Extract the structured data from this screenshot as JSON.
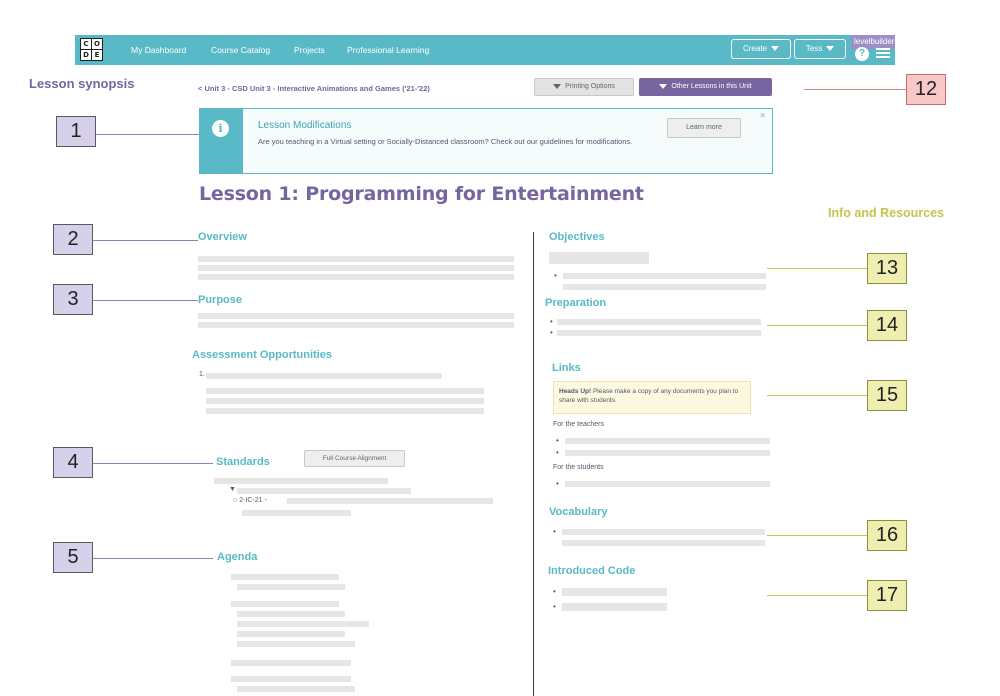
{
  "nav": {
    "logo_letters": [
      "C",
      "O",
      "D",
      "E"
    ],
    "links": [
      "My Dashboard",
      "Course Catalog",
      "Projects",
      "Professional Learning"
    ],
    "create_label": "Create",
    "user_label": "Tess",
    "levelbuilder_label": "levelbuilder"
  },
  "headings": {
    "lesson_synopsis": "Lesson synopsis",
    "info_resources": "Info and Resources"
  },
  "breadcrumb": "< Unit 3 - CSD Unit 3 - Interactive Animations and Games ('21-'22)",
  "buttons": {
    "printing": "Printing Options",
    "other_lessons": "Other Lessons in this Unit",
    "learn_more": "Learn more",
    "full_alignment": "Full Course Alignment"
  },
  "banner": {
    "title": "Lesson Modifications",
    "text": "Are you teaching in a Virtual setting or Socially-Distanced classroom? Check out our guidelines for modifications.",
    "close": "×"
  },
  "lesson_title": "Lesson 1: Programming for Entertainment",
  "left_sections": {
    "overview": "Overview",
    "purpose": "Purpose",
    "assessment": "Assessment Opportunities",
    "assessment_number": "1.",
    "standards": "Standards",
    "standard_code": "2-IC-21 -",
    "agenda": "Agenda"
  },
  "right_sections": {
    "objectives": "Objectives",
    "preparation": "Preparation",
    "links": "Links",
    "headsup_bold": "Heads Up!",
    "headsup_text": " Please make a copy of any documents you plan to share with students.",
    "for_teachers": "For the teachers",
    "for_students": "For the students",
    "vocabulary": "Vocabulary",
    "introduced_code": "Introduced Code"
  },
  "callouts": {
    "c1": "1",
    "c2": "2",
    "c3": "3",
    "c4": "4",
    "c5": "5",
    "c12": "12",
    "c13": "13",
    "c14": "14",
    "c15": "15",
    "c16": "16",
    "c17": "17"
  },
  "colors": {
    "nav": "#59b9c6",
    "purple": "#7665a0",
    "teal": "#59b9c6",
    "olive": "#c5c44d",
    "callout_purple": "#d6d0ea",
    "callout_red": "#f8c7c7",
    "callout_yellow": "#eeeeb0"
  }
}
